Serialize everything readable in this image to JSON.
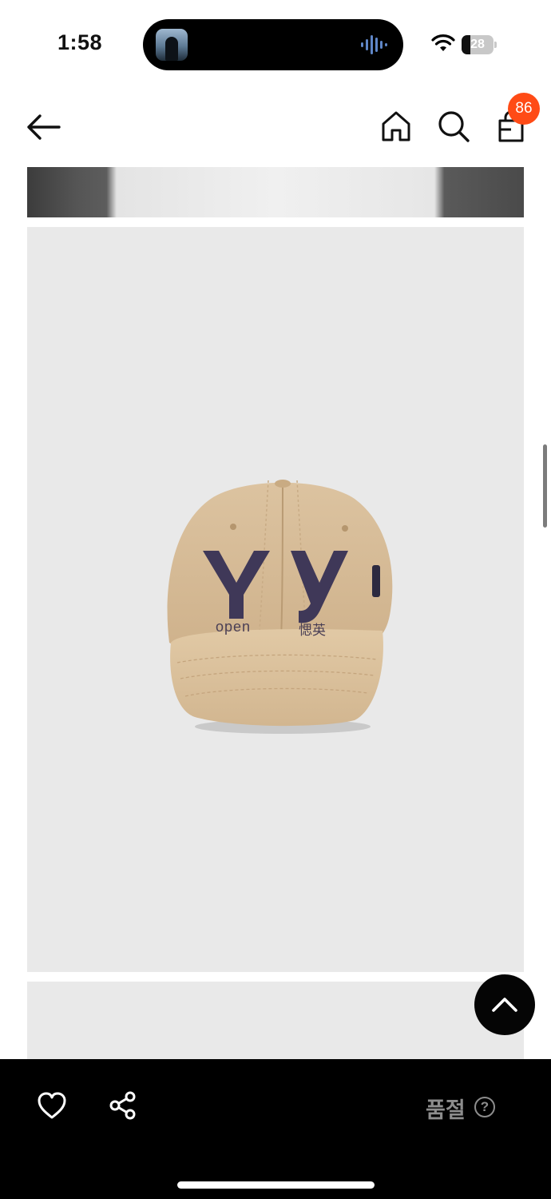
{
  "status_bar": {
    "time": "1:58",
    "battery_level": "28",
    "battery_fraction": 0.28,
    "icons": [
      "wifi-icon",
      "battery-icon",
      "audio-wave-icon"
    ]
  },
  "header": {
    "icons": [
      "back-arrow-icon",
      "home-icon",
      "search-icon",
      "shopping-bag-icon"
    ],
    "cart_badge": "86",
    "badge_color": "#ff4b16"
  },
  "product": {
    "cap_text_left": "open",
    "cap_text_right": "愢英"
  },
  "floating": {
    "icons": [
      "chevron-up-icon"
    ]
  },
  "bottom_bar": {
    "icons": [
      "heart-icon",
      "share-icon",
      "help-circle-icon"
    ],
    "sold_out_label": "품절",
    "help_label": "?"
  },
  "colors": {
    "background": "#ffffff",
    "image_panel": "#e9e9e9",
    "bottom_bar": "#000000",
    "muted_text": "#8d8d8d"
  }
}
